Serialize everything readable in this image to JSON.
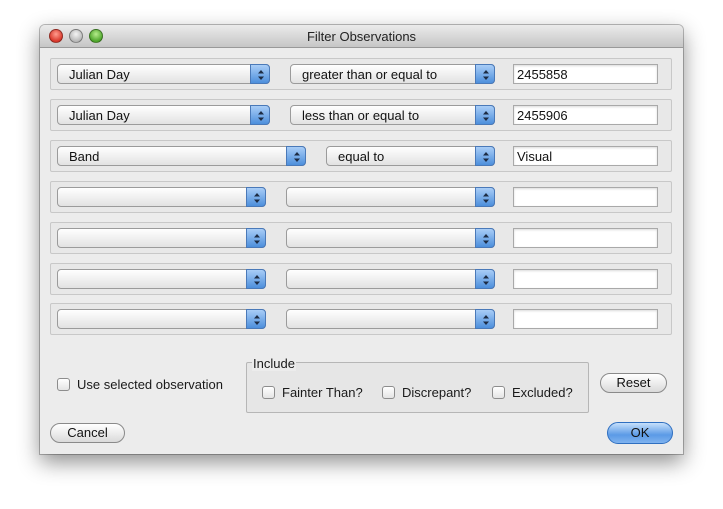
{
  "window": {
    "title": "Filter Observations"
  },
  "rows": [
    {
      "field": "Julian Day",
      "operator": "greater than or equal to",
      "value": "2455858"
    },
    {
      "field": "Julian Day",
      "operator": "less than or equal to",
      "value": "2455906"
    },
    {
      "field": "Band",
      "operator": "equal to",
      "value": "Visual"
    },
    {
      "field": "",
      "operator": "",
      "value": ""
    },
    {
      "field": "",
      "operator": "",
      "value": ""
    },
    {
      "field": "",
      "operator": "",
      "value": ""
    },
    {
      "field": "",
      "operator": "",
      "value": ""
    }
  ],
  "use_selected": {
    "label": "Use selected observation",
    "checked": false
  },
  "include": {
    "title": "Include",
    "options": [
      {
        "label": "Fainter Than?",
        "checked": false
      },
      {
        "label": "Discrepant?",
        "checked": false
      },
      {
        "label": "Excluded?",
        "checked": false
      }
    ]
  },
  "buttons": {
    "reset": "Reset",
    "cancel": "Cancel",
    "ok": "OK"
  },
  "icons": {
    "window_controls": [
      "close-icon",
      "minimize-icon",
      "zoom-icon"
    ],
    "popup": "updown-arrows-icon"
  }
}
